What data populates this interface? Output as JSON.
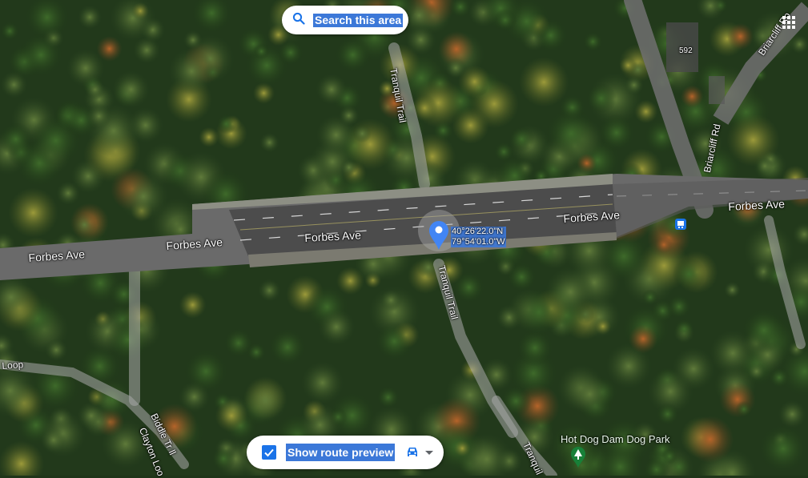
{
  "search": {
    "label": "Search this area",
    "icon": "search-icon"
  },
  "route_preview": {
    "label": "Show route preview",
    "checked": true,
    "mode_icon": "car-icon"
  },
  "marker": {
    "lat": "40°26'22.0\"N",
    "lng": "79°54'01.0\"W",
    "color": "#4285f4"
  },
  "labels": {
    "forbes_1": "Forbes Ave",
    "forbes_2": "Forbes Ave",
    "forbes_3": "Forbes Ave",
    "forbes_4": "Forbes Ave",
    "forbes_5": "Forbes Ave",
    "tranquil_top": "Tranquil Trail",
    "tranquil_mid": "Tranquil Trail",
    "tranquil_bottom": "Tranquil",
    "briarcliff_1": "Briarcliff Rd",
    "briarcliff_2": "Briarcliff Ro",
    "loop": "Loop",
    "biddle": "Biddle Tr ll",
    "clayton": "Clayton Loo",
    "address": "592"
  },
  "park": {
    "name": "Hot Dog Dam Dog Park",
    "icon": "park-tree-icon",
    "color": "#188038"
  },
  "colors": {
    "road": "#6e6e6e",
    "trail": "#8a8a8a",
    "bus_stop": "#1a73e8"
  }
}
